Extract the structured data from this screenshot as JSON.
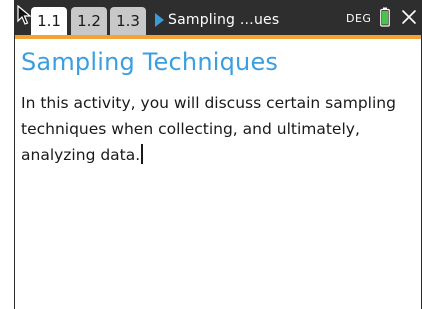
{
  "topbar": {
    "tabs": [
      {
        "label": "1.1",
        "active": true
      },
      {
        "label": "1.2",
        "active": false
      },
      {
        "label": "1.3",
        "active": false
      }
    ],
    "document_title": "Sampling …ues",
    "angle_mode": "DEG",
    "icons": {
      "pointer": "cursor-arrow-icon",
      "play": "play-triangle-icon",
      "battery": "battery-icon",
      "close": "close-icon"
    }
  },
  "page": {
    "heading": "Sampling Techniques",
    "body": "In this activity, you will discuss certain sampling techniques when collecting, and ultimately, analyzing data."
  },
  "colors": {
    "topbar_bg": "#2e2e2e",
    "accent_orange": "#f4a233",
    "heading_blue": "#3a9fe0",
    "battery_green": "#4cc24a"
  }
}
